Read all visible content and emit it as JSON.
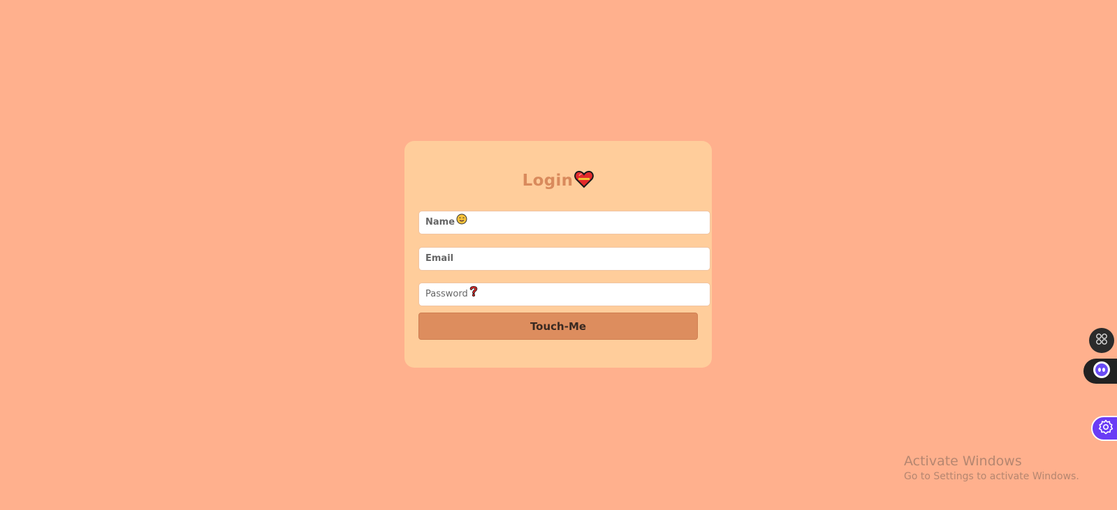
{
  "login": {
    "title": "Login",
    "fields": {
      "name_placeholder": "Name",
      "email_placeholder": "Email",
      "password_placeholder": "Password"
    },
    "submit_label": "Touch-Me"
  },
  "side_widgets": {
    "grid_icon": "grid-icon",
    "bot_icon": "bot-face-icon",
    "settings_icon": "gear-icon"
  },
  "watermark": {
    "title": "Activate Windows",
    "subtitle": "Go to Settings to activate Windows."
  },
  "colors": {
    "background": "#ffb08d",
    "card": "#ffcd9b",
    "title": "#d98a5c",
    "button": "#dd8d5e",
    "accent_purple": "#6a3cf5"
  }
}
